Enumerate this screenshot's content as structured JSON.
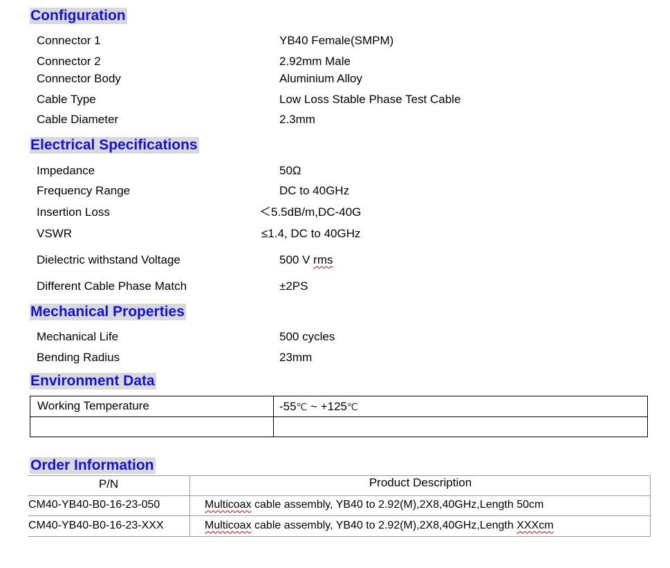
{
  "configuration": {
    "title": "Configuration",
    "rows": [
      {
        "label": "Connector 1",
        "value": "YB40 Female(SMPM)"
      },
      {
        "label": "Connector 2",
        "value": "2.92mm Male"
      },
      {
        "label": "Connector Body",
        "value": "Aluminium Alloy"
      },
      {
        "label": "Cable Type",
        "value": "Low Loss Stable Phase Test Cable"
      },
      {
        "label": "Cable Diameter",
        "value": "2.3mm"
      }
    ]
  },
  "electrical": {
    "title": "Electrical Specifications",
    "rows": [
      {
        "label": "Impedance",
        "value": "50Ω"
      },
      {
        "label": "Frequency Range",
        "value": "DC to 40GHz"
      },
      {
        "label": "Insertion Loss",
        "value": "＜5.5dB/m,DC-40G"
      },
      {
        "label": "VSWR",
        "value": "≤1.4, DC to 40GHz"
      },
      {
        "label": "Dielectric withstand Voltage",
        "value_main": "500 V ",
        "value_unit": "rms"
      },
      {
        "label": "Different Cable Phase Match",
        "value": "±2PS"
      }
    ]
  },
  "mechanical": {
    "title": "Mechanical Properties",
    "rows": [
      {
        "label": "Mechanical Life",
        "value": "500 cycles"
      },
      {
        "label": "Bending Radius",
        "value": "23mm"
      }
    ]
  },
  "environment": {
    "title": "Environment Data",
    "rows": [
      {
        "label": "Working Temperature",
        "value_a": "-55",
        "unit_a": "℃",
        "sep": " ~ ",
        "value_b": "+125",
        "unit_b": "℃"
      }
    ]
  },
  "order": {
    "title": "Order Information",
    "headers": {
      "pn": "P/N",
      "desc": "Product Description"
    },
    "rows": [
      {
        "pn": "CM40-YB40-B0-16-23-050",
        "desc_a": "Multicoax",
        "desc_b": " cable assembly, YB40 to 2.92(M),2X8,40GHz,Length 50cm"
      },
      {
        "pn": "CM40-YB40-B0-16-23-XXX",
        "desc_a": "Multicoax",
        "desc_b": " cable assembly,  YB40 to 2.92(M),2X8,40GHz,Length ",
        "desc_c": "XXXcm"
      }
    ]
  }
}
